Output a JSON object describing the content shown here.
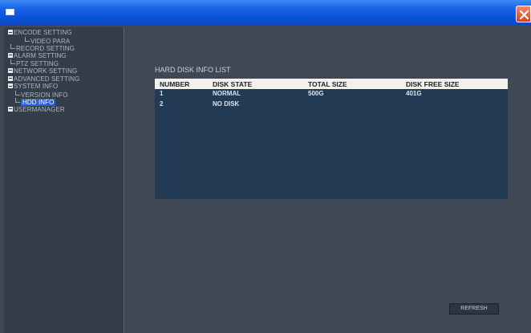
{
  "sidebar": {
    "items": [
      {
        "label": "ENCODE SETTING"
      },
      {
        "label": "VIDEO PARA"
      },
      {
        "label": "RECORD SETTING"
      },
      {
        "label": "ALARM SETTING"
      },
      {
        "label": "PTZ SETTING"
      },
      {
        "label": "NETWORK SETTING"
      },
      {
        "label": "ADVANCED SETTING"
      },
      {
        "label": "SYSTEM INFO"
      },
      {
        "label": "VERSION INFO"
      },
      {
        "label": "HDD INFO"
      },
      {
        "label": "USERMANAGER"
      }
    ]
  },
  "main": {
    "title": "HARD DISK INFO LIST",
    "table": {
      "columns": [
        "NUMBER",
        "DISK STATE",
        "TOTAL SIZE",
        "DISK FREE SIZE"
      ],
      "rows": [
        [
          "1",
          "NORMAL",
          "500G",
          "401G"
        ],
        [
          "2",
          "NO DISK",
          "",
          ""
        ]
      ]
    },
    "refresh_label": "REFRESH"
  },
  "colors": {
    "titlebar": "#0a52d8",
    "selected": "#2b5ed8",
    "table_bg": "#223a54"
  }
}
